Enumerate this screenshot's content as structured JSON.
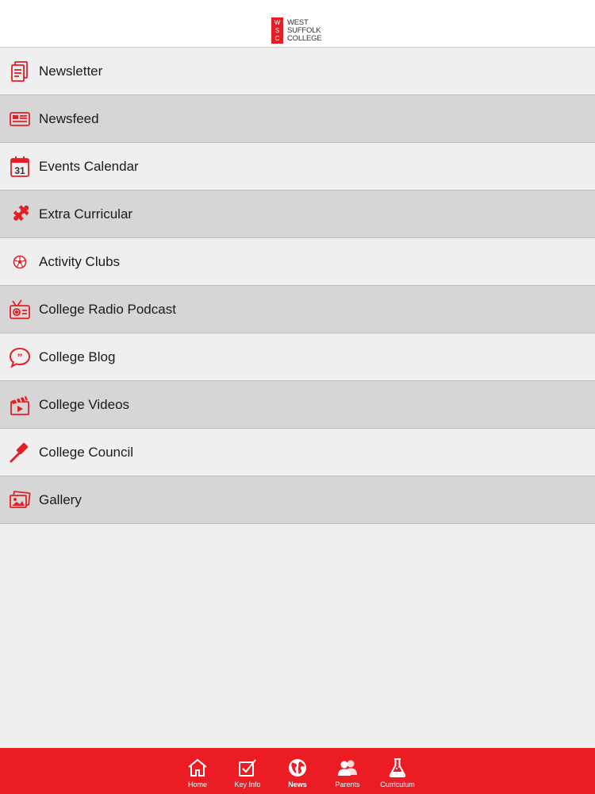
{
  "header": {
    "logo_letters": [
      "W",
      "S",
      "C"
    ],
    "logo_lines": [
      "WEST",
      "SUFFOLK",
      "COLLEGE"
    ]
  },
  "menu": {
    "items": [
      {
        "label": "Newsletter",
        "icon": "newsletter-icon"
      },
      {
        "label": "Newsfeed",
        "icon": "newspaper-icon"
      },
      {
        "label": "Events Calendar",
        "icon": "calendar-icon",
        "icon_text": "31"
      },
      {
        "label": "Extra Curricular",
        "icon": "puzzle-icon"
      },
      {
        "label": "Activity Clubs",
        "icon": "football-icon"
      },
      {
        "label": "College Radio Podcast",
        "icon": "radio-icon"
      },
      {
        "label": "College Blog",
        "icon": "speech-bubble-icon"
      },
      {
        "label": "College Videos",
        "icon": "clapperboard-icon"
      },
      {
        "label": "College Council",
        "icon": "gavel-icon"
      },
      {
        "label": "Gallery",
        "icon": "gallery-icon"
      }
    ]
  },
  "tabbar": {
    "active": "News",
    "tabs": [
      {
        "label": "Home",
        "icon": "home-icon"
      },
      {
        "label": "Key Info",
        "icon": "checkbox-icon"
      },
      {
        "label": "News",
        "icon": "globe-icon"
      },
      {
        "label": "Parents",
        "icon": "people-icon"
      },
      {
        "label": "Curriculum",
        "icon": "flask-icon"
      }
    ]
  },
  "colors": {
    "accent": "#e31f26",
    "tabbar": "#ec1c24",
    "row_light": "#efefef",
    "row_dark": "#d6d6d6"
  }
}
